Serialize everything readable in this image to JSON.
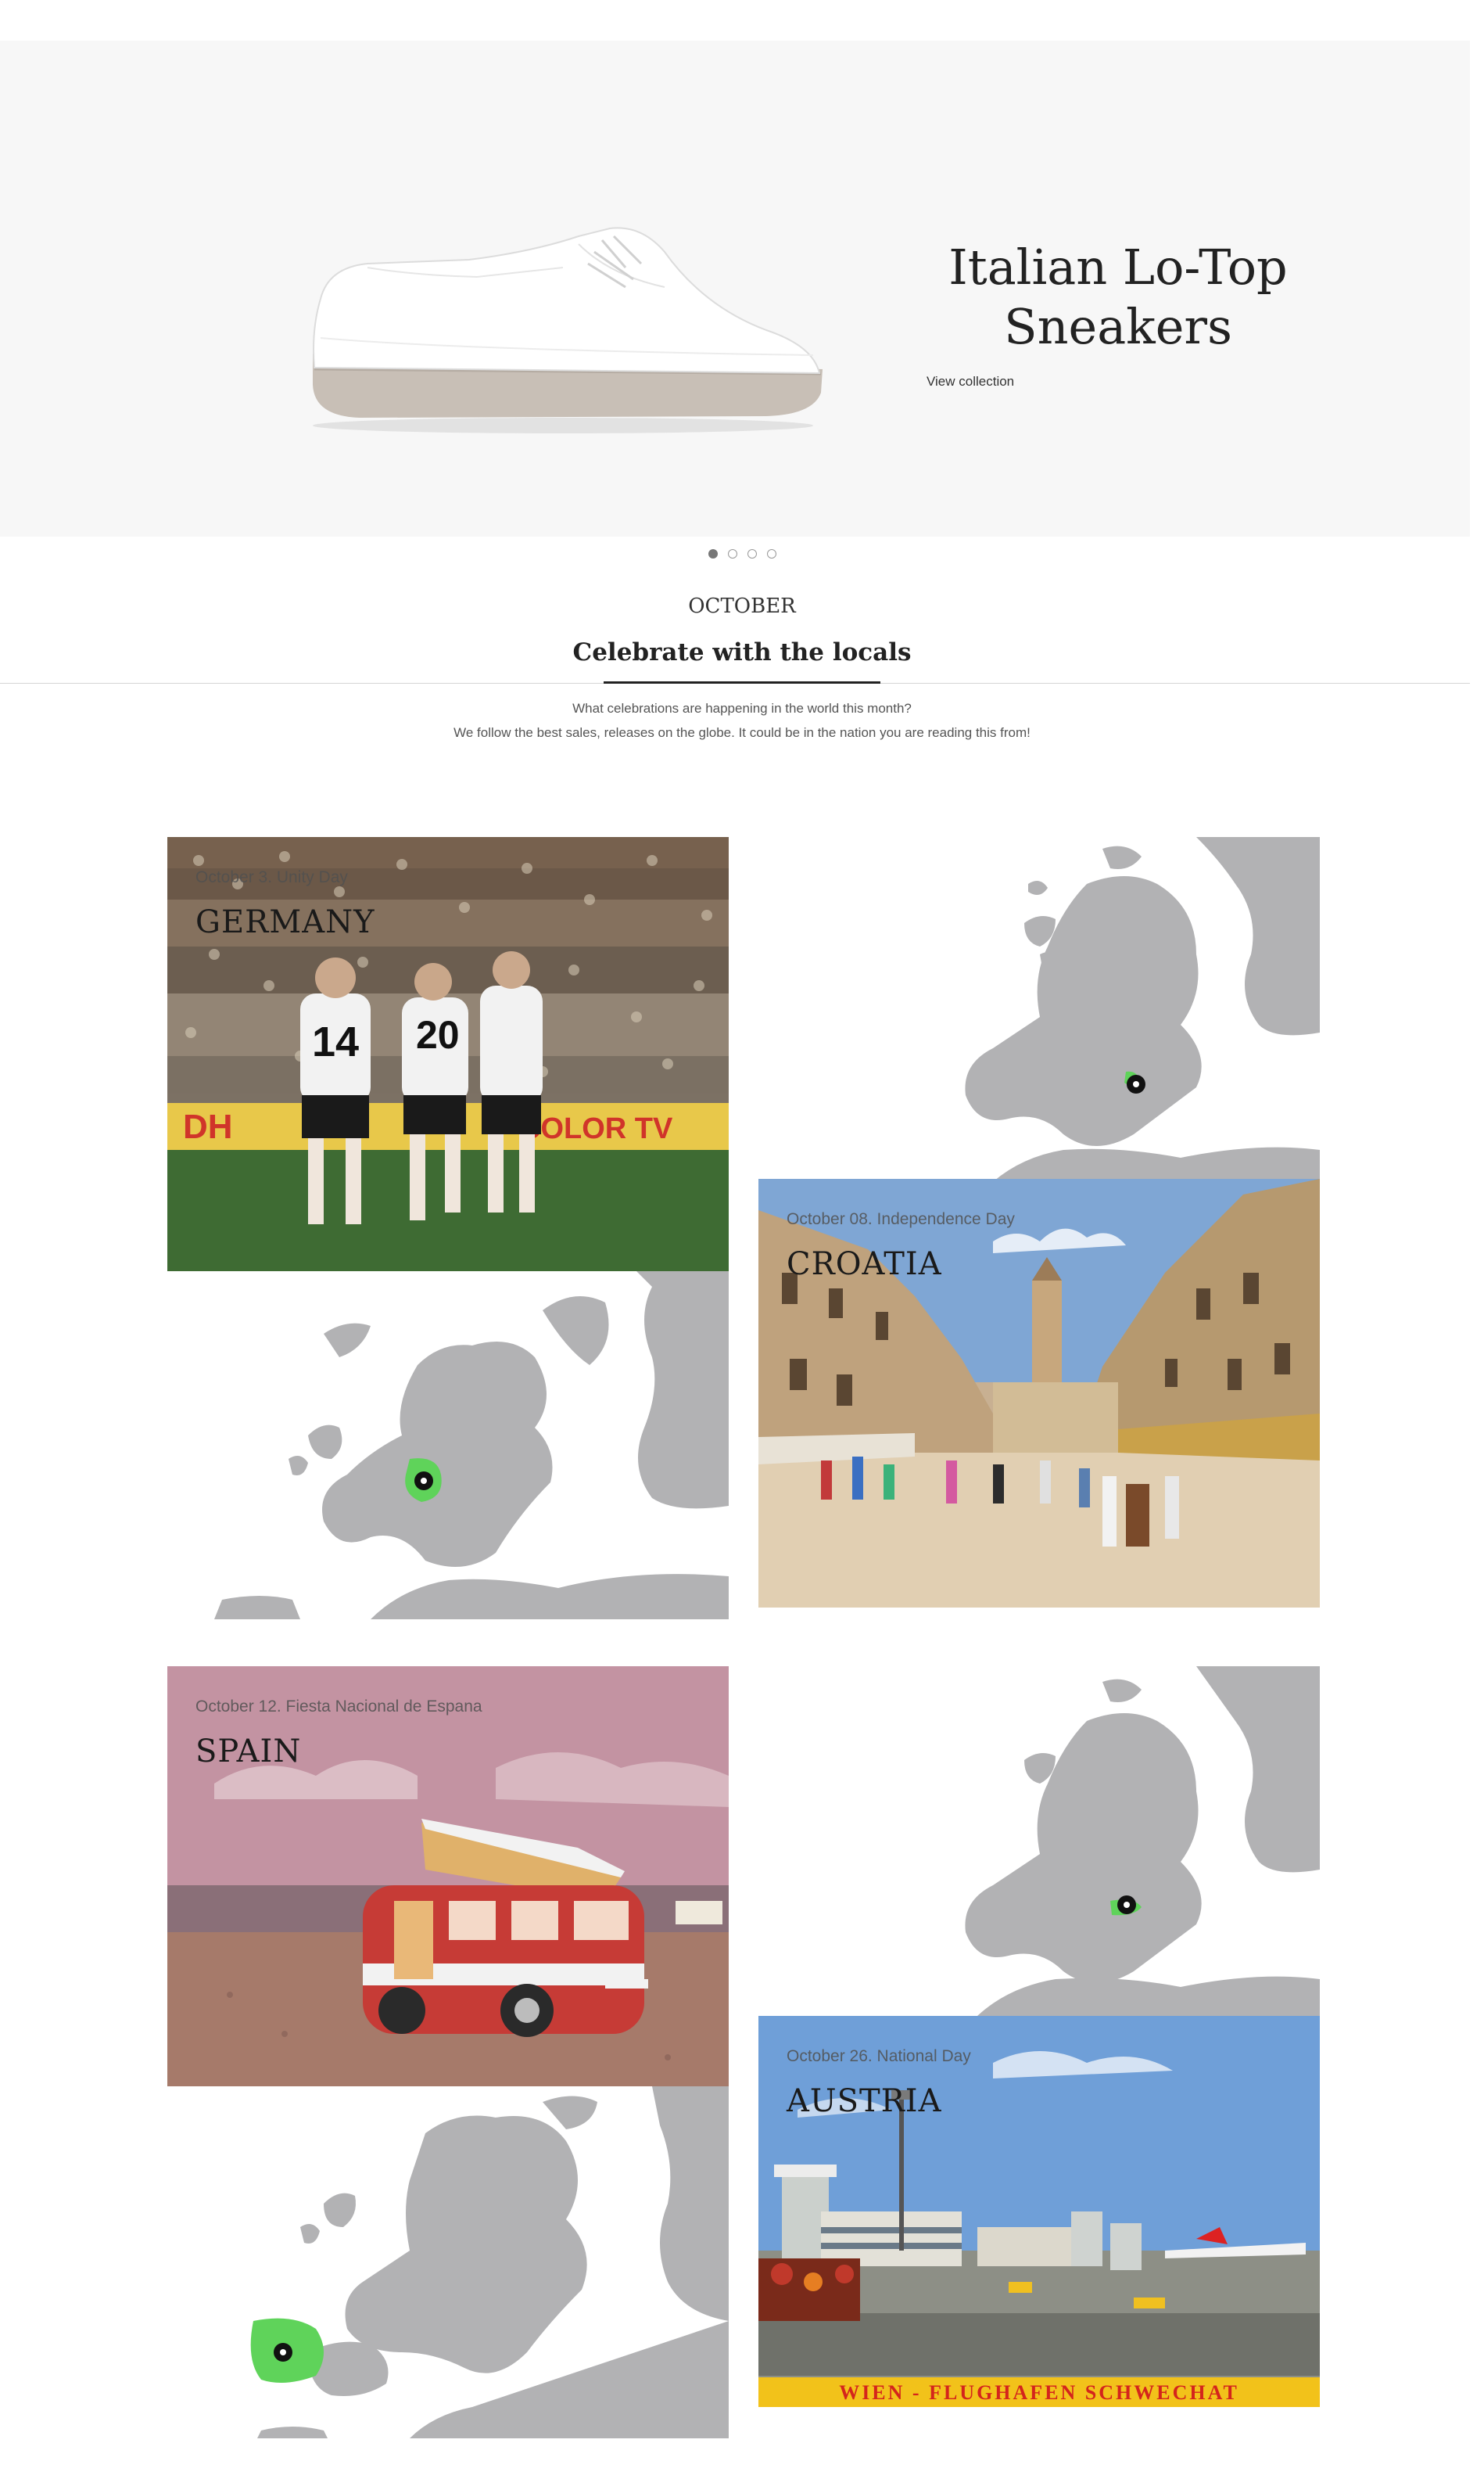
{
  "hero": {
    "title_line1": "Italian Lo-Top",
    "title_line2": "Sneakers",
    "link": "View collection",
    "slides": 4,
    "active_slide": 1
  },
  "section": {
    "month": "OCTOBER",
    "title": "Celebrate with the locals",
    "intro_line1": "What celebrations are happening in the world this month?",
    "intro_line2": "We follow the best sales, releases on the globe. It could be in the nation you are reading this from!"
  },
  "cards": [
    {
      "date": "October 3. Unity Day",
      "country": "GERMANY",
      "highlight_color": "#5fd35a"
    },
    {
      "date": "October 08. Independence Day",
      "country": "CROATIA",
      "highlight_color": "#5fd35a"
    },
    {
      "date": "October 12. Fiesta Nacional de Espana",
      "country": "SPAIN",
      "highlight_color": "#5fd35a"
    },
    {
      "date": "October 26. National Day",
      "country": "AUSTRIA",
      "highlight_color": "#5fd35a"
    }
  ],
  "postcard_banner": "WIEN - FLUGHAFEN SCHWECHAT",
  "stadium_banner": "COLOR TV",
  "colors": {
    "map_land": "#b2b2b4",
    "highlight": "#5fd35a",
    "pin": "#111111"
  }
}
